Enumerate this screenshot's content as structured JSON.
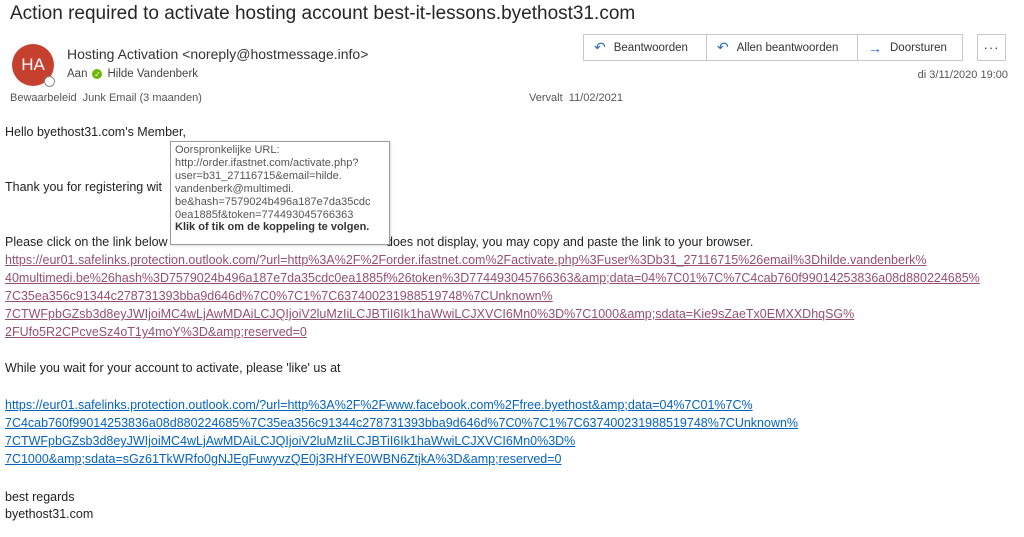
{
  "subject": "Action required to activate hosting account best-it-lessons.byethost31.com",
  "sender": {
    "initials": "HA",
    "display": "Hosting Activation <noreply@hostmessage.info>",
    "to_prefix": "Aan",
    "recipient": "Hilde Vandenberk"
  },
  "meta": {
    "retention_label": "Bewaarbeleid",
    "retention_value": "Junk Email (3 maanden)",
    "expires_label": "Vervalt",
    "expires_value": "11/02/2021",
    "date": "di 3/11/2020 19:00"
  },
  "actions": {
    "reply": "Beantwoorden",
    "reply_all": "Allen beantwoorden",
    "forward": "Doorsturen",
    "more": "···"
  },
  "icons": {
    "reply": "reply-arrow-icon",
    "reply_all": "reply-all-arrow-icon",
    "forward": "forward-arrow-icon",
    "check": "check-icon"
  },
  "colors": {
    "avatar": "#c6402f",
    "visited_link": "#954f72",
    "link": "#0563c1",
    "action_icon": "#2b6cc4",
    "check": "#6bb700"
  },
  "body": {
    "greeting": "Hello byethost31.com's Member,",
    "thanks": "Thank you for registering wit",
    "instruction_left": "Please click on the link below",
    "instruction_right": "does not display, you may copy and paste the link to your browser.",
    "activation_link_lines": [
      "https://eur01.safelinks.protection.outlook.com/?url=http%3A%2F%2Forder.ifastnet.com%2Factivate.php%3Fuser%3Db31_27116715%26email%3Dhilde.vandenberk%",
      "40multimedi.be%26hash%3D7579024b496a187e7da35cdc0ea1885f%26token%3D774493045766363&amp;data=04%7C01%7C%7C4cab760f99014253836a08d880224685%",
      "7C35ea356c91344c278731393bba9d646d%7C0%7C1%7C637400231988519748%7CUnknown%",
      "7CTWFpbGZsb3d8eyJWIjoiMC4wLjAwMDAiLCJQIjoiV2luMzIiLCJBTiI6Ik1haWwiLCJXVCI6Mn0%3D%7C1000&amp;sdata=Kie9sZaeTx0EMXXDhqSG%",
      "2FUfo5R2CPcveSz4oT1y4moY%3D&amp;reserved=0"
    ],
    "like_text": "While you wait for your account to activate, please 'like' us at",
    "facebook_link_lines": [
      "https://eur01.safelinks.protection.outlook.com/?url=http%3A%2F%2Fwww.facebook.com%2Ffree.byethost&amp;data=04%7C01%7C%",
      "7C4cab760f99014253836a08d880224685%7C35ea356c91344c278731393bba9d646d%7C0%7C1%7C637400231988519748%7CUnknown%",
      "7CTWFpbGZsb3d8eyJWIjoiMC4wLjAwMDAiLCJQIjoiV2luMzIiLCJBTiI6Ik1haWwiLCJXVCI6Mn0%3D%",
      "7C1000&amp;sdata=sGz61TkWRfo0gNJEgFuwyvzQE0j3RHfYE0WBN6ZtjkA%3D&amp;reserved=0"
    ],
    "regards": "best regards",
    "signature": "byethost31.com"
  },
  "tooltip": {
    "lines": [
      "Oorspronkelijke URL:",
      "http://order.ifastnet.com/activate.php?",
      "user=b31_27116715&email=hilde.",
      "vandenberk@multimedi.",
      "be&hash=7579024b496a187e7da35cdc",
      "0ea1885f&token=774493045766363"
    ],
    "action_hint": "Klik of tik om de koppeling te volgen."
  }
}
